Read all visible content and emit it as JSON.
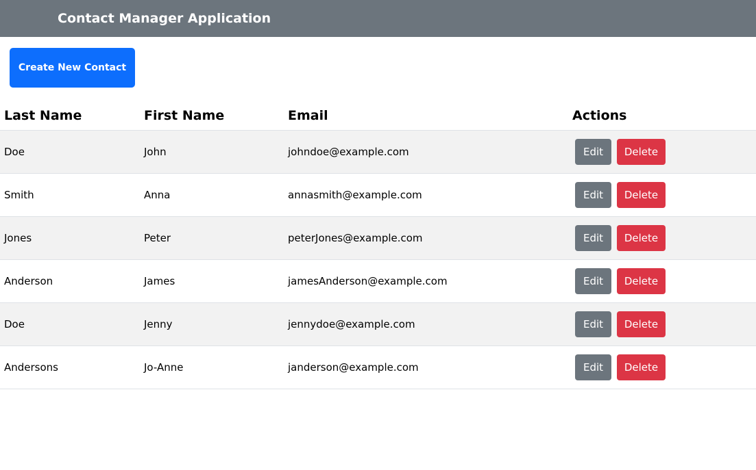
{
  "header": {
    "title": "Contact Manager Application"
  },
  "toolbar": {
    "create_label": "Create New Contact"
  },
  "table": {
    "columns": [
      "Last Name",
      "First Name",
      "Email",
      "Actions"
    ],
    "edit_label": "Edit",
    "delete_label": "Delete",
    "rows": [
      {
        "last": "Doe",
        "first": "John",
        "email": "johndoe@example.com"
      },
      {
        "last": "Smith",
        "first": "Anna",
        "email": "annasmith@example.com"
      },
      {
        "last": "Jones",
        "first": "Peter",
        "email": "peterJones@example.com"
      },
      {
        "last": "Anderson",
        "first": "James",
        "email": "jamesAnderson@example.com"
      },
      {
        "last": "Doe",
        "first": "Jenny",
        "email": "jennydoe@example.com"
      },
      {
        "last": "Andersons",
        "first": "Jo-Anne",
        "email": "janderson@example.com"
      }
    ]
  },
  "colors": {
    "header_bg": "#6c757d",
    "primary": "#0d6efd",
    "secondary": "#6c757d",
    "danger": "#dc3545",
    "stripe": "#f2f2f2"
  }
}
